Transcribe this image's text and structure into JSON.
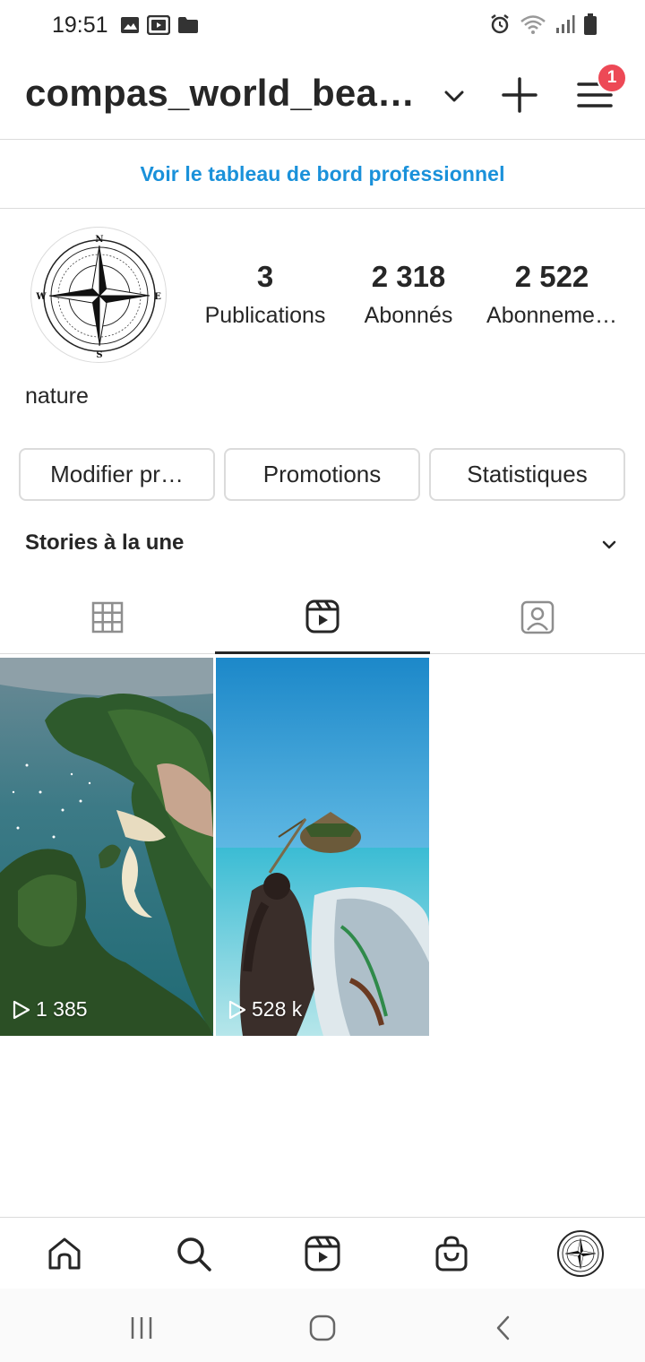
{
  "status_bar": {
    "time": "19:51",
    "left_icons": [
      "gallery-icon",
      "youtube-icon",
      "folder-icon"
    ],
    "right_icons": [
      "alarm-icon",
      "wifi-icon",
      "signal-icon",
      "battery-icon"
    ]
  },
  "header": {
    "account_name": "compas_world_bea…",
    "notification_count": "1"
  },
  "dashboard": {
    "link_label": "Voir le tableau de bord professionnel",
    "color": "#1a91da"
  },
  "profile": {
    "stats": [
      {
        "value": "3",
        "label": "Publications"
      },
      {
        "value": "2 318",
        "label": "Abonnés"
      },
      {
        "value": "2 522",
        "label": "Abonneme…"
      }
    ],
    "bio": "nature",
    "avatar_letters": {
      "n": "N",
      "s": "S",
      "e": "E",
      "w": "W"
    }
  },
  "actions": {
    "edit_label": "Modifier pr…",
    "promotions_label": "Promotions",
    "insights_label": "Statistiques"
  },
  "highlights": {
    "title": "Stories à la une"
  },
  "tabs": {
    "items": [
      "grid-icon",
      "reels-icon",
      "tagged-icon"
    ],
    "active_index": 1
  },
  "posts": [
    {
      "views": "1 385",
      "scene": "tropical islands aerial"
    },
    {
      "views": "528 k",
      "scene": "boat approaching rock restaurant"
    }
  ],
  "bottom_nav": {
    "items": [
      "home-icon",
      "search-icon",
      "reels-icon",
      "shop-icon",
      "profile-avatar"
    ]
  },
  "colors": {
    "badge": "#ed4956",
    "text": "#262626",
    "border": "#dbdbdb"
  }
}
